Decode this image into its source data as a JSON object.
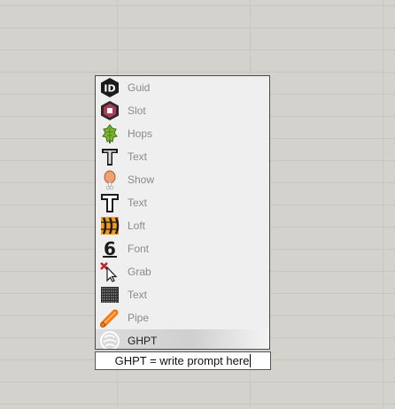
{
  "popup": {
    "items": [
      {
        "label": "Guid",
        "icon": "guid-hexagon-icon"
      },
      {
        "label": "Slot",
        "icon": "slot-hexagon-icon"
      },
      {
        "label": "Hops",
        "icon": "hops-icon"
      },
      {
        "label": "Text",
        "icon": "text-t-icon"
      },
      {
        "label": "Show",
        "icon": "show-drumstick-icon"
      },
      {
        "label": "Text",
        "icon": "text-outline-t-icon"
      },
      {
        "label": "Loft",
        "icon": "loft-icon"
      },
      {
        "label": "Font",
        "icon": "font-icon"
      },
      {
        "label": "Grab",
        "icon": "grab-cursor-icon"
      },
      {
        "label": "Text",
        "icon": "text-pattern-icon"
      },
      {
        "label": "Pipe",
        "icon": "pipe-icon"
      },
      {
        "label": "GHPT",
        "icon": "ghpt-icon",
        "selected": true
      }
    ]
  },
  "prompt": {
    "value": "GHPT = write prompt here"
  }
}
